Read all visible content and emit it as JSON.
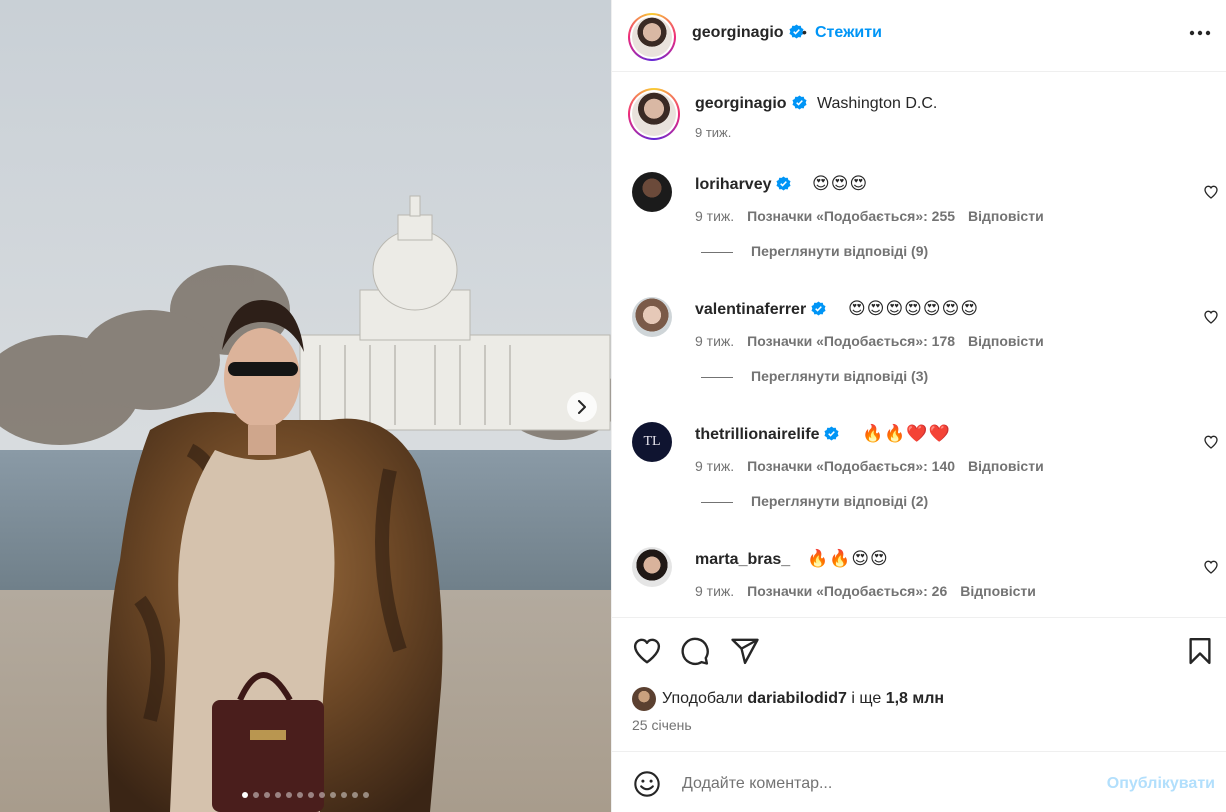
{
  "header": {
    "username": "georginagio",
    "separator": "•",
    "follow_label": "Стежити"
  },
  "caption": {
    "username": "georginagio",
    "text": "Washington D.C.",
    "time": "9 тиж."
  },
  "comments": [
    {
      "username": "loriharvey",
      "text": "😍😍😍",
      "time": "9 тиж.",
      "likes": "Позначки «Подобається»: 255",
      "reply_label": "Відповісти",
      "view_replies": "Переглянути відповіді (9)"
    },
    {
      "username": "valentinaferrer",
      "text": "😍😍😍😍😍😍😍",
      "time": "9 тиж.",
      "likes": "Позначки «Подобається»: 178",
      "reply_label": "Відповісти",
      "view_replies": "Переглянути відповіді (3)"
    },
    {
      "username": "thetrillionairelife",
      "text": "🔥🔥❤️❤️",
      "time": "9 тиж.",
      "likes": "Позначки «Подобається»: 140",
      "reply_label": "Відповісти",
      "view_replies": "Переглянути відповіді (2)"
    },
    {
      "username": "marta_bras_",
      "text": "🔥🔥😍😍",
      "time": "9 тиж.",
      "likes": "Позначки «Подобається»: 26",
      "reply_label": "Відповісти"
    }
  ],
  "likes": {
    "prefix": "Уподобали",
    "user": "dariabilodid7",
    "middle": "і ще",
    "count": "1,8 млн"
  },
  "post_date": "25 січень",
  "comment_box": {
    "placeholder": "Додайте коментар...",
    "publish_label": "Опублікувати"
  },
  "carousel": {
    "slide_count": 12,
    "active_slide": 1
  },
  "colors": {
    "accent": "#0095f6",
    "verified": "#0095f6",
    "muted_text": "#737373",
    "publish_disabled": "#b2dffc"
  },
  "icons": [
    "verified-badge-icon",
    "more-options-icon",
    "heart-icon",
    "comment-icon",
    "share-icon",
    "bookmark-icon",
    "emoji-icon",
    "chevron-right-icon"
  ]
}
